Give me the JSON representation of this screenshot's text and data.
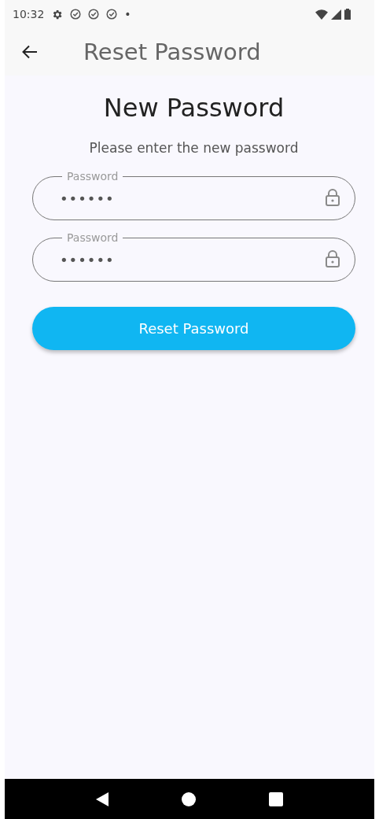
{
  "status_bar": {
    "time": "10:32",
    "dot": "•"
  },
  "app_bar": {
    "title": "Reset Password"
  },
  "heading": "New Password",
  "subtitle": "Please enter the new password",
  "fields": [
    {
      "label": "Password",
      "value": "••••••"
    },
    {
      "label": "Password",
      "value": "••••••"
    }
  ],
  "submit_button": "Reset Password"
}
